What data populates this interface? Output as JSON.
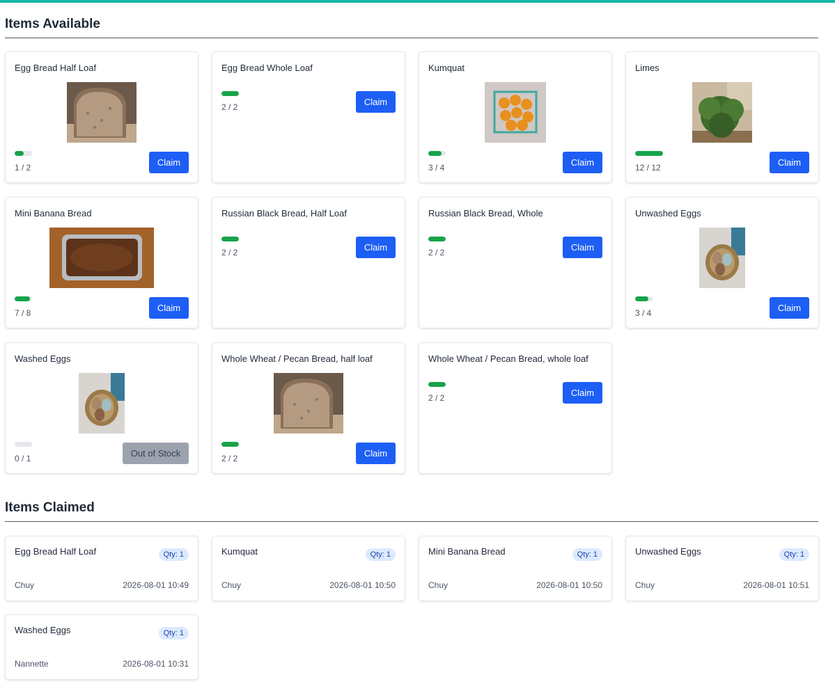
{
  "available": {
    "title": "Items Available",
    "claim_label": "Claim",
    "oos_label": "Out of Stock",
    "items": [
      {
        "name": "Egg Bread Half Loaf",
        "remaining": 1,
        "total": 2,
        "count": "1 / 2",
        "photo": "bread-photo"
      },
      {
        "name": "Egg Bread Whole Loaf",
        "remaining": 2,
        "total": 2,
        "count": "2 / 2",
        "photo": null
      },
      {
        "name": "Kumquat",
        "remaining": 3,
        "total": 4,
        "count": "3 / 4",
        "photo": "kumquat-photo"
      },
      {
        "name": "Limes",
        "remaining": 12,
        "total": 12,
        "count": "12 / 12",
        "photo": "lime-tree-photo"
      },
      {
        "name": "Mini Banana Bread",
        "remaining": 7,
        "total": 8,
        "count": "7 / 8",
        "photo": "banana-bread-photo"
      },
      {
        "name": "Russian Black Bread, Half Loaf",
        "remaining": 2,
        "total": 2,
        "count": "2 / 2",
        "photo": null
      },
      {
        "name": "Russian Black Bread, Whole",
        "remaining": 2,
        "total": 2,
        "count": "2 / 2",
        "photo": null
      },
      {
        "name": "Unwashed Eggs",
        "remaining": 3,
        "total": 4,
        "count": "3 / 4",
        "photo": "egg-basket-photo"
      },
      {
        "name": "Washed Eggs",
        "remaining": 0,
        "total": 1,
        "count": "0 / 1",
        "photo": "egg-basket-photo"
      },
      {
        "name": "Whole Wheat / Pecan Bread, half loaf",
        "remaining": 2,
        "total": 2,
        "count": "2 / 2",
        "photo": "bread-photo"
      },
      {
        "name": "Whole Wheat / Pecan Bread, whole loaf",
        "remaining": 2,
        "total": 2,
        "count": "2 / 2",
        "photo": null
      }
    ]
  },
  "claimed": {
    "title": "Items Claimed",
    "items": [
      {
        "name": "Egg Bread Half Loaf",
        "qty": "Qty: 1",
        "who": "Chuy",
        "when": "2026-08-01 10:49"
      },
      {
        "name": "Kumquat",
        "qty": "Qty: 1",
        "who": "Chuy",
        "when": "2026-08-01 10:50"
      },
      {
        "name": "Mini Banana Bread",
        "qty": "Qty: 1",
        "who": "Chuy",
        "when": "2026-08-01 10:50"
      },
      {
        "name": "Unwashed Eggs",
        "qty": "Qty: 1",
        "who": "Chuy",
        "when": "2026-08-01 10:51"
      },
      {
        "name": "Washed Eggs",
        "qty": "Qty: 1",
        "who": "Nannette",
        "when": "2026-08-01 10:31"
      }
    ]
  },
  "colors": {
    "accent": "#14b8a6",
    "button": "#1d5ef5",
    "progress": "#16a34a",
    "disabled": "#9ca3af"
  }
}
